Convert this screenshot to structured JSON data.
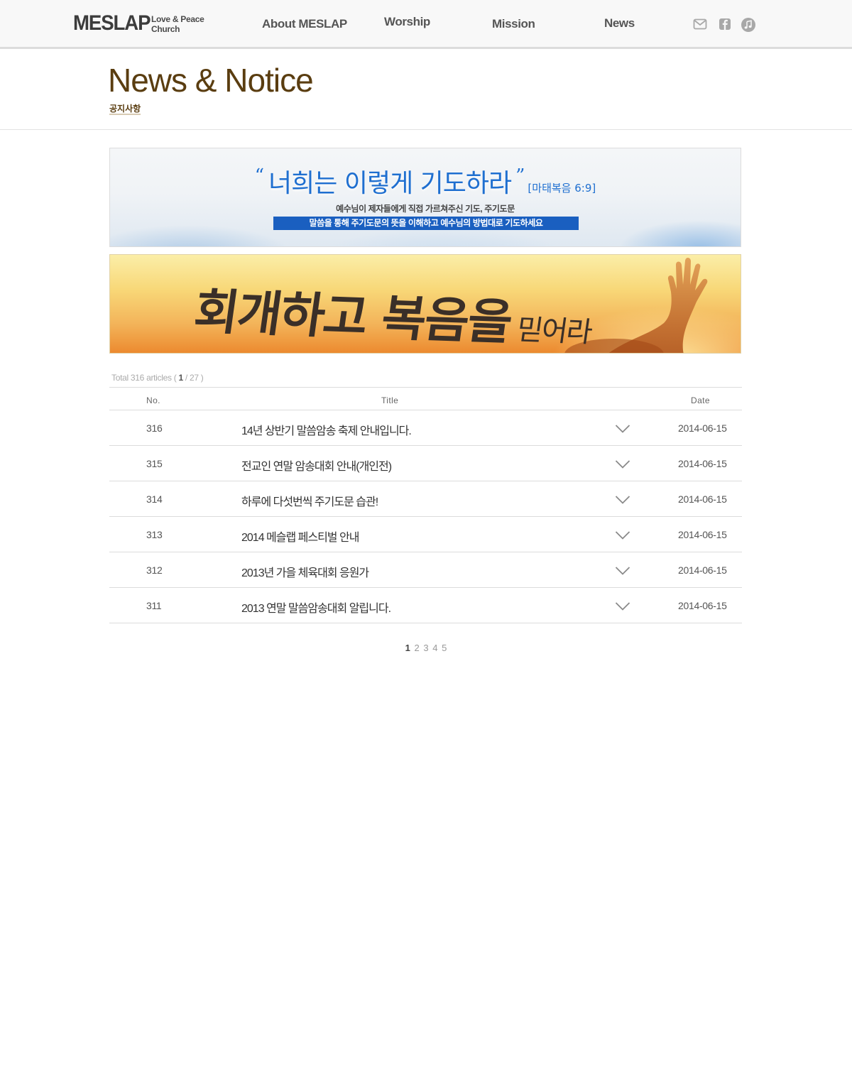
{
  "header": {
    "logo_main": "MESLAP",
    "logo_sub_1": "Love & Peace",
    "logo_sub_2": "Church",
    "nav": [
      "About MESLAP",
      "Worship",
      "Mission",
      "News"
    ],
    "icons": [
      "mail-icon",
      "facebook-icon",
      "music-icon"
    ],
    "icon_color": "#a8a8a8"
  },
  "page": {
    "title": "News & Notice",
    "subtitle": "공지사항",
    "title_color": "#5a3d10"
  },
  "banner1": {
    "open_quote": "“",
    "main": "너희는 이렇게 기도하라",
    "close_quote": "”",
    "ref": "[마태복음 6:9]",
    "line1": "예수님이 제자들에게 직접 가르쳐주신 기도, 주기도문",
    "line2": "말씀을 통해 주기도문의 뜻을 이해하고 예수님의 방법대로 기도하세요",
    "accent_color": "#1a5fc0"
  },
  "banner2": {
    "text": "회개하고 복음을",
    "text_small": "믿어라"
  },
  "board": {
    "total_label": "Total",
    "total_count": "316",
    "articles_label": "articles",
    "page_current": "1",
    "page_total": "27",
    "columns": {
      "no": "No.",
      "title": "Title",
      "date": "Date"
    },
    "rows": [
      {
        "no": "316",
        "title": "14년 상반기 말씀암송 축제 안내입니다.",
        "date": "2014-06-15"
      },
      {
        "no": "315",
        "title": "전교인 연말 암송대회 안내(개인전)",
        "date": "2014-06-15"
      },
      {
        "no": "314",
        "title": "하루에 다섯번씩 주기도문 습관!",
        "date": "2014-06-15"
      },
      {
        "no": "313",
        "title": "2014 메슬랩 페스티벌 안내",
        "date": "2014-06-15"
      },
      {
        "no": "312",
        "title": "2013년 가을 체육대회 응원가",
        "date": "2014-06-15"
      },
      {
        "no": "311",
        "title": "2013 연말 말씀암송대회 알립니다.",
        "date": "2014-06-15"
      }
    ]
  },
  "pagination": [
    "1",
    "2",
    "3",
    "4",
    "5"
  ]
}
